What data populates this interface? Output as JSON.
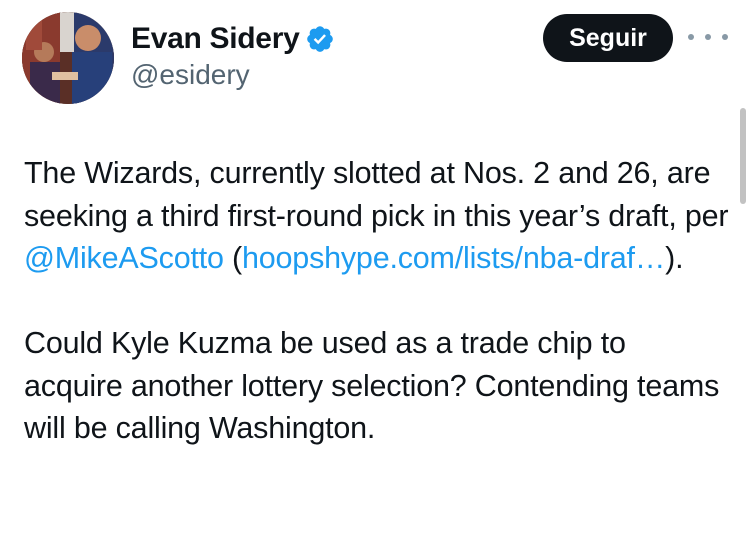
{
  "author": {
    "name": "Evan Sidery",
    "handle": "@esidery",
    "verified": true
  },
  "actions": {
    "follow_label": "Seguir",
    "more_icon": "more-horizontal-icon"
  },
  "tweet": {
    "p1_part1": "The Wizards, currently slotted at Nos. 2 and 26, are seeking a third first-round pick in this year’s draft, per ",
    "mention": "@MikeAScotto",
    "p1_part2": " (",
    "link_text": "hoopshype.com/lists/nba-draf…",
    "p1_part3": ").",
    "p2": "Could Kyle Kuzma be used as a trade chip to acquire another lottery selection? Contending teams will be calling Washington."
  },
  "colors": {
    "text": "#0f1419",
    "secondary": "#536471",
    "link": "#1d9bf0",
    "verified": "#1d9bf0",
    "button_bg": "#0f1419",
    "button_text": "#ffffff"
  }
}
